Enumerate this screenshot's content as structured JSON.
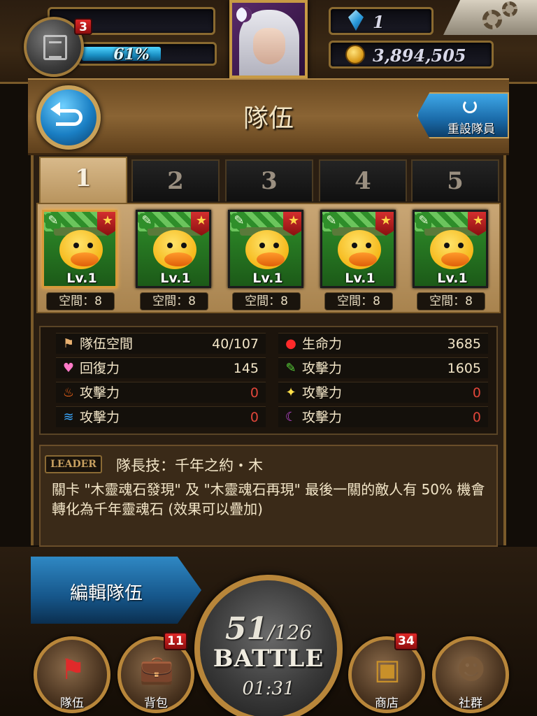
{
  "status": {
    "level_count": "3",
    "exp_percent_label": "61%",
    "exp_fraction": 0.61,
    "gems": "1",
    "coins": "3,894,505"
  },
  "header": {
    "title": "隊伍",
    "back_icon": "back-arrow-icon",
    "reset_label": "重設隊員"
  },
  "tabs": [
    "1",
    "2",
    "3",
    "4",
    "5"
  ],
  "active_tab": "1",
  "team": [
    {
      "level": "Lv.1",
      "space": "空間：8"
    },
    {
      "level": "Lv.1",
      "space": "空間：8"
    },
    {
      "level": "Lv.1",
      "space": "空間：8"
    },
    {
      "level": "Lv.1",
      "space": "空間：8"
    },
    {
      "level": "Lv.1",
      "space": "空間：8"
    }
  ],
  "stats": {
    "left": [
      {
        "icon": "flag-icon",
        "label": "隊伍空間",
        "value": "40/107",
        "color": "#e8b070"
      },
      {
        "icon": "heart-icon",
        "label": "回復力",
        "value": "145",
        "color": "#ff7ac8"
      },
      {
        "icon": "fire-icon",
        "label": "攻擊力",
        "value": "0",
        "color": "#ff6a1a"
      },
      {
        "icon": "water-icon",
        "label": "攻擊力",
        "value": "0",
        "color": "#3aa8ff"
      }
    ],
    "right": [
      {
        "icon": "hp-drop-icon",
        "label": "生命力",
        "value": "3685",
        "color": "#ff2a2a"
      },
      {
        "icon": "wood-icon",
        "label": "攻擊力",
        "value": "1605",
        "color": "#5ad43a"
      },
      {
        "icon": "light-icon",
        "label": "攻擊力",
        "value": "0",
        "color": "#ffe04a"
      },
      {
        "icon": "dark-icon",
        "label": "攻擊力",
        "value": "0",
        "color": "#c04ad8"
      }
    ]
  },
  "leader": {
    "tag": "LEADER",
    "title": "隊長技：千年之約・木",
    "description": "關卡 \"木靈魂石發現\" 及 \"木靈魂石再現\" 最後一關的敵人有 50% 機會轉化為千年靈魂石 (效果可以疊加)"
  },
  "bottom": {
    "edit_team_label": "編輯隊伍",
    "battle_current": "51",
    "battle_max": "/126",
    "battle_label": "BATTLE",
    "battle_timer": "01:31",
    "nav": [
      {
        "icon": "red-flag-icon",
        "label": "隊伍",
        "badge": ""
      },
      {
        "icon": "bag-icon",
        "label": "背包",
        "badge": "11"
      },
      {
        "icon": "treasure-chest-icon",
        "label": "商店",
        "badge": "34"
      },
      {
        "icon": "people-icon",
        "label": "社群",
        "badge": ""
      }
    ]
  }
}
